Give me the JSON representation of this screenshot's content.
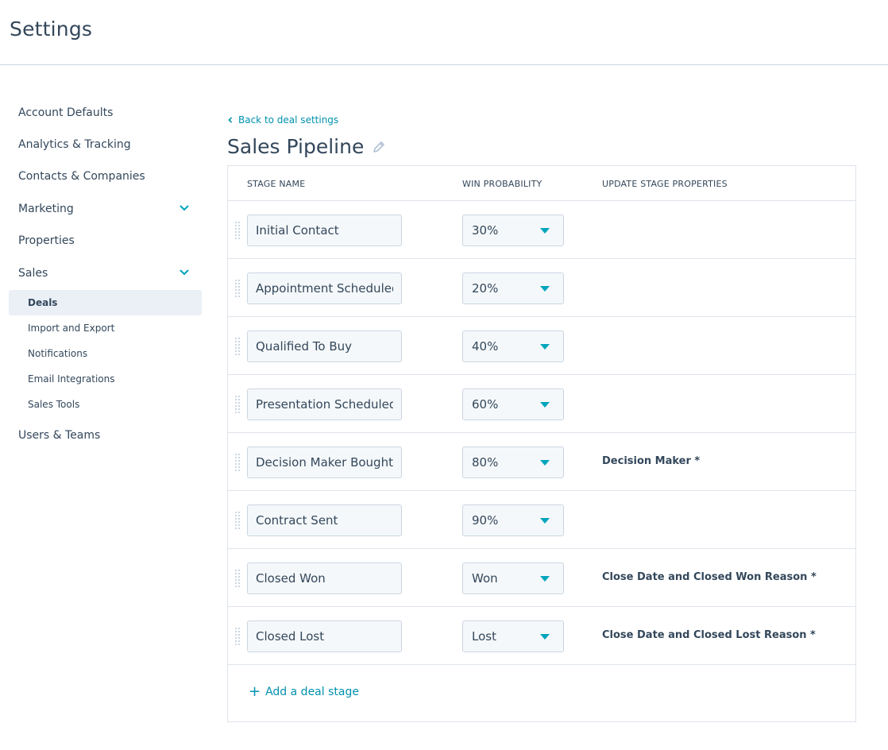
{
  "header": {
    "title": "Settings"
  },
  "sidebar": {
    "items": [
      {
        "label": "Account Defaults"
      },
      {
        "label": "Analytics & Tracking"
      },
      {
        "label": "Contacts & Companies"
      },
      {
        "label": "Marketing",
        "expandable": true
      },
      {
        "label": "Properties"
      },
      {
        "label": "Sales",
        "expandable": true
      }
    ],
    "sales_subitems": [
      {
        "label": "Deals",
        "active": true
      },
      {
        "label": "Import and Export"
      },
      {
        "label": "Notifications"
      },
      {
        "label": "Email Integrations"
      },
      {
        "label": "Sales Tools"
      }
    ],
    "users_teams": "Users & Teams"
  },
  "main": {
    "back_link": "Back to deal settings",
    "title": "Sales Pipeline",
    "table": {
      "headers": {
        "stage_name": "STAGE NAME",
        "win_probability": "WIN PROBABILITY",
        "update_properties": "UPDATE STAGE PROPERTIES"
      },
      "rows": [
        {
          "stage": "Initial Contact",
          "probability": "30%",
          "properties": ""
        },
        {
          "stage": "Appointment Scheduled",
          "probability": "20%",
          "properties": ""
        },
        {
          "stage": "Qualified To Buy",
          "probability": "40%",
          "properties": ""
        },
        {
          "stage": "Presentation Scheduled",
          "probability": "60%",
          "properties": ""
        },
        {
          "stage": "Decision Maker Bought-In",
          "probability": "80%",
          "properties": "Decision Maker *"
        },
        {
          "stage": "Contract Sent",
          "probability": "90%",
          "properties": ""
        },
        {
          "stage": "Closed Won",
          "probability": "Won",
          "properties": "Close Date and Closed Won Reason *"
        },
        {
          "stage": "Closed Lost",
          "probability": "Lost",
          "properties": "Close Date and Closed Lost Reason *"
        }
      ]
    },
    "add_stage": "Add a deal stage"
  },
  "colors": {
    "text": "#33475b",
    "link": "#0091ae",
    "accent": "#00a4bd",
    "border": "#dfe3eb",
    "active_bg": "#eaf0f6"
  }
}
